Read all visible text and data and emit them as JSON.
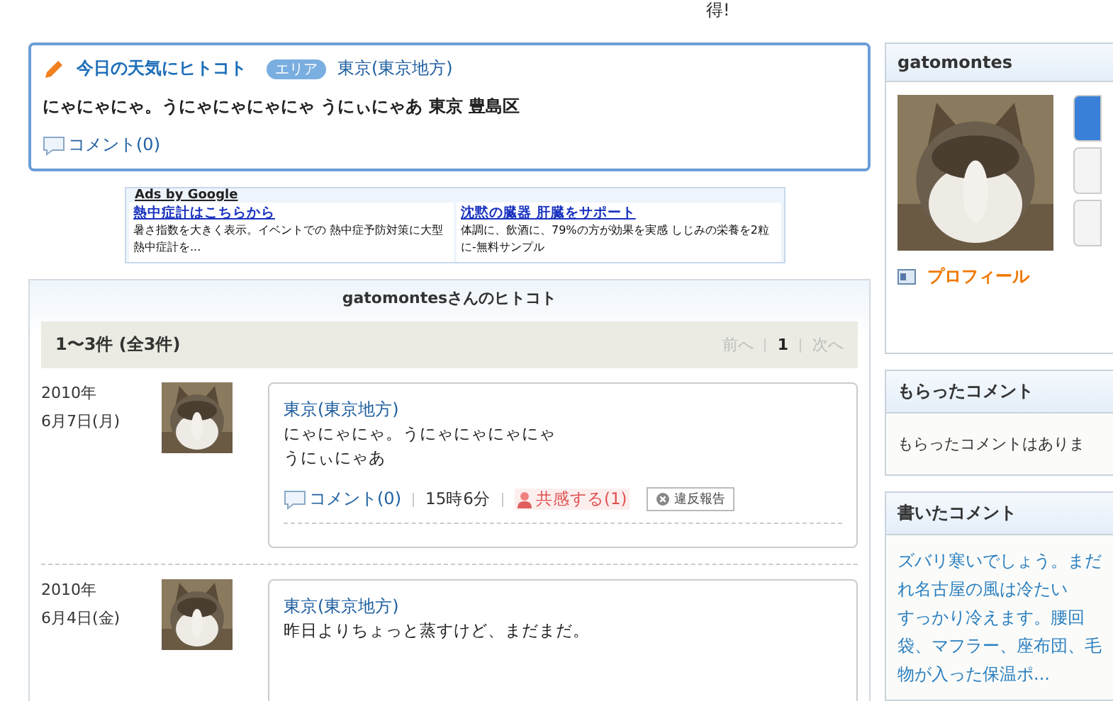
{
  "top_fragment": "得!",
  "hitokoto_card": {
    "title": "今日の天気にヒトコト",
    "area_badge": "エリア",
    "area": "東京(東京地方)",
    "text": "にゃにゃにゃ。うにゃにゃにゃにゃ うにぃにゃあ 東京 豊島区",
    "comment_link": "コメント(0)"
  },
  "ads": {
    "header": "Ads by Google",
    "items": [
      {
        "title": "熱中症計はこちらから",
        "text": "暑さ指数を大きく表示。イベントでの 熱中症予防対策に大型熱中症計を..."
      },
      {
        "title": "沈黙の臓器 肝臓をサポート",
        "text": "体調に、飲酒に、79%の方が効果を実感 しじみの栄養を2粒に-無料サンプル"
      }
    ]
  },
  "list": {
    "title": "gatomontesさんのヒトコト",
    "count": "1〜3件 (全3件)",
    "pager": [
      {
        "label": "前へ",
        "current": false
      },
      {
        "label": "1",
        "current": true
      },
      {
        "label": "次へ",
        "current": false
      }
    ],
    "entries": [
      {
        "year": "2010年",
        "day": "6月7日(月)",
        "area": "東京(東京地方)",
        "lines": [
          "にゃにゃにゃ。うにゃにゃにゃにゃ",
          "うにぃにゃあ"
        ],
        "comment_link": "コメント(0)",
        "time": "15時6分",
        "empathy": "共感する(1)",
        "report": "違反報告"
      },
      {
        "year": "2010年",
        "day": "6月4日(金)",
        "area": "東京(東京地方)",
        "lines": [
          "昨日よりちょっと蒸すけど、まだまだ。"
        ]
      }
    ]
  },
  "sidebar": {
    "profile": {
      "name": "gatomontes",
      "profile_link": "プロフィール"
    },
    "received": {
      "title": "もらったコメント",
      "text": "もらったコメントはありま"
    },
    "written": {
      "title": "書いたコメント",
      "lines": [
        "ズバリ寒いでしょう。まだ",
        "れ名古屋の風は冷たい",
        "すっかり冷えます。腰回",
        "袋、マフラー、座布団、毛",
        "物が入った保温ポ..."
      ]
    }
  }
}
